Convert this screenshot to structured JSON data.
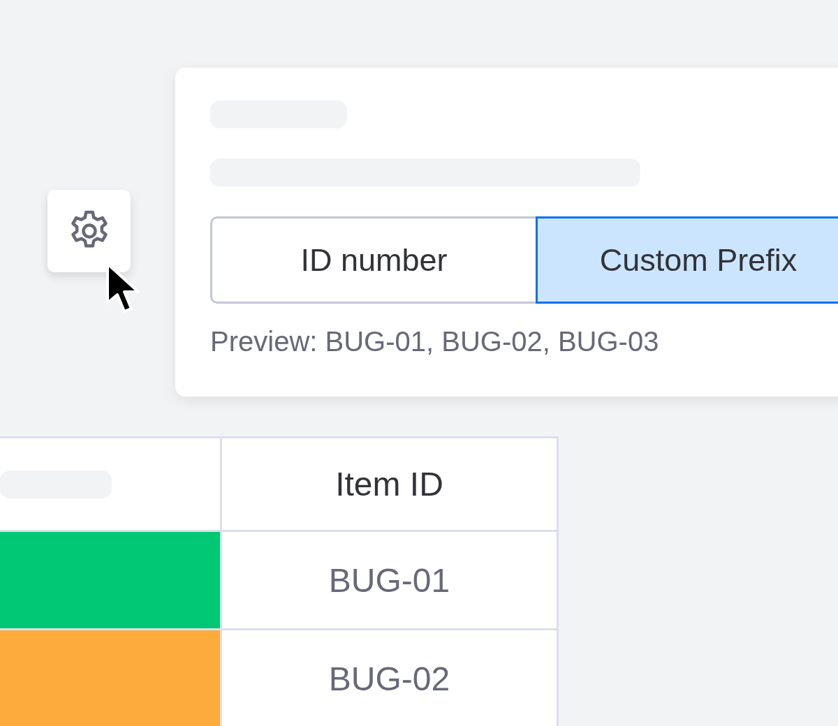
{
  "settings_card": {
    "options": [
      {
        "label": "ID number",
        "selected": false
      },
      {
        "label": "Custom Prefix",
        "selected": true
      }
    ],
    "preview": "Preview: BUG-01, BUG-02, BUG-03"
  },
  "table": {
    "header": "Item ID",
    "rows": [
      {
        "color": "#00c875",
        "id": "BUG-01"
      },
      {
        "color": "#fdab3d",
        "id": "BUG-02"
      }
    ]
  }
}
